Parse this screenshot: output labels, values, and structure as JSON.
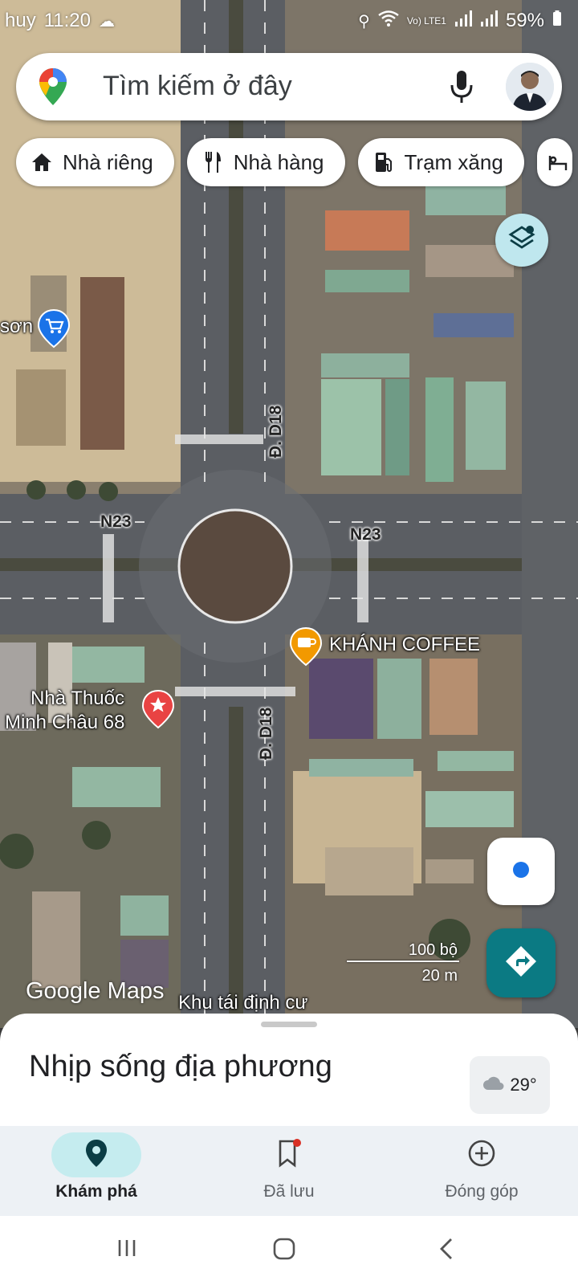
{
  "status_bar": {
    "carrier": "huy",
    "time": "11:20",
    "network": "Vo) LTE1",
    "battery": "59%"
  },
  "search": {
    "placeholder": "Tìm kiếm ở đây",
    "icons": [
      "google-maps-pin-icon",
      "microphone-icon",
      "avatar"
    ]
  },
  "chips": [
    {
      "label": "Nhà riêng",
      "icon": "home-icon"
    },
    {
      "label": "Nhà hàng",
      "icon": "restaurant-icon"
    },
    {
      "label": "Trạm xăng",
      "icon": "gas-station-icon"
    }
  ],
  "map": {
    "road_labels": {
      "d18_top": "Đ. D18",
      "d18_bottom": "Đ. D18",
      "n23_left": "N23",
      "n23_right": "N23"
    },
    "pois": {
      "shop": "sơn",
      "coffee": "KHÁNH COFFEE",
      "pharmacy_line1": "Nhà Thuốc",
      "pharmacy_line2": "Minh Châu 68",
      "bottom_place": "Khu tái định cư"
    },
    "logo": "Google Maps",
    "scale": {
      "imperial": "100 bộ",
      "metric": "20 m"
    }
  },
  "sheet": {
    "title": "Nhịp sống địa phương",
    "weather": "29°"
  },
  "bottom_nav": [
    {
      "label": "Khám phá",
      "icon": "explore-pin-icon",
      "active": true
    },
    {
      "label": "Đã lưu",
      "icon": "bookmark-icon",
      "active": false
    },
    {
      "label": "Đóng góp",
      "icon": "add-circle-icon",
      "active": false
    }
  ],
  "colors": {
    "accent_teal": "#0b7a83",
    "active_pill": "#c5ecef",
    "location_blue": "#1a73e8",
    "poi_orange": "#f29900",
    "poi_red": "#e94343"
  }
}
